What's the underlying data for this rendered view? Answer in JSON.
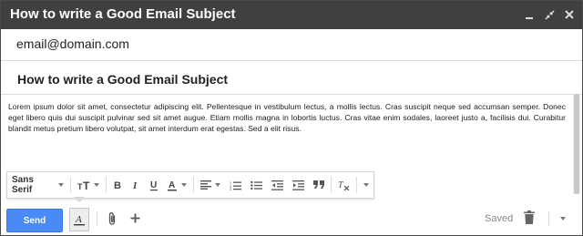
{
  "window": {
    "title": "How to write a Good Email Subject"
  },
  "controls": {
    "minimize": "minimize-icon",
    "popout": "popout-icon",
    "close": "close-icon"
  },
  "compose": {
    "to": "email@domain.com",
    "subject": "How to write a Good Email Subject",
    "body": "Lorem ipsum dolor sit amet, consectetur adipiscing elit. Pellentesque in vestibulum lectus, a mollis lectus. Cras suscipit neque sed accumsan semper. Donec eget libero quis dui suscipit pulvinar sed sit amet augue. Etiam mollis magna in lobortis luctus. Cras vitae enim sodales, laoreet justo a, facilisis dui. Curabitur blandit metus pretium libero volutpat, sit amet interdum erat egestas. Sed a elit risus."
  },
  "formatting": {
    "font": "Sans Serif"
  },
  "footer": {
    "send_label": "Send",
    "status": "Saved"
  },
  "colors": {
    "titlebar": "#404040",
    "send": "#4a8af4"
  }
}
